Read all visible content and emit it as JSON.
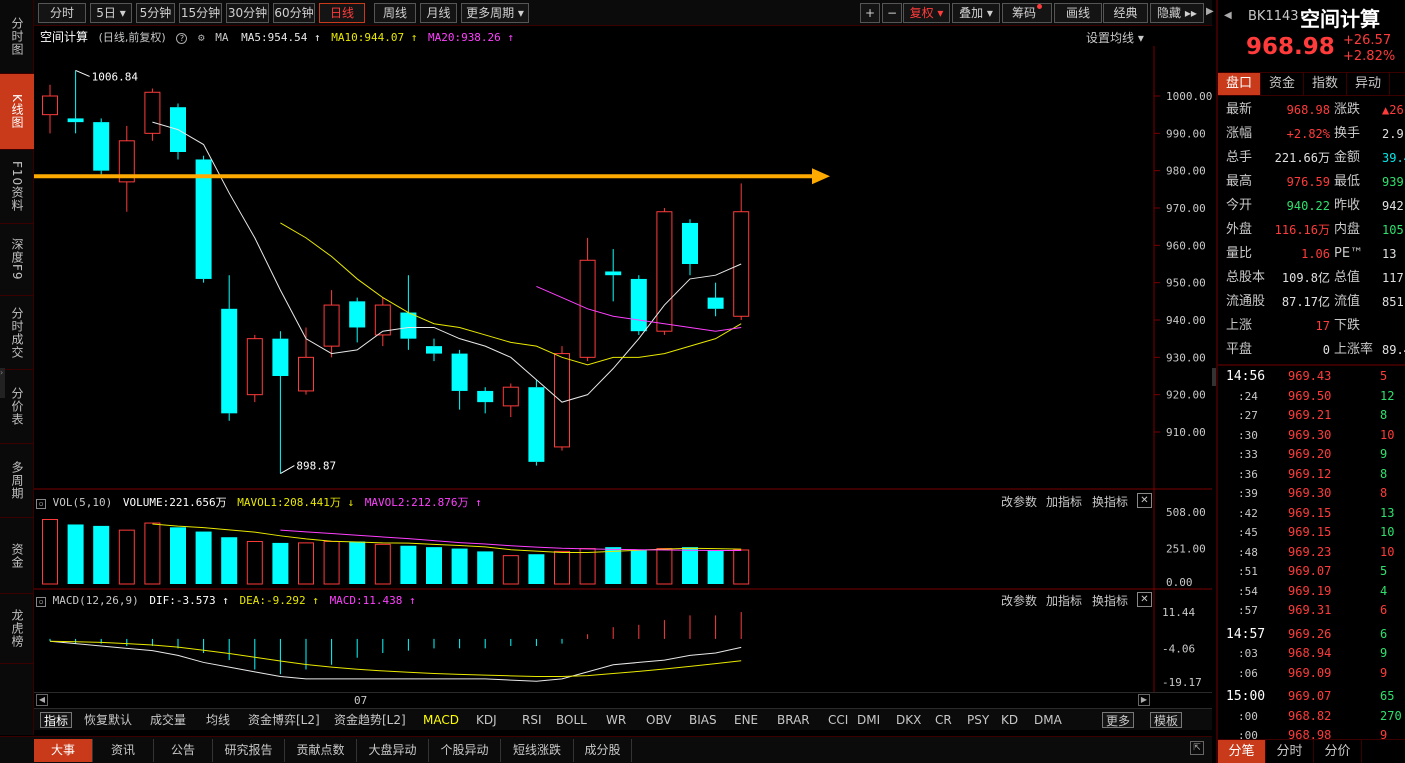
{
  "nav": [
    "分时图",
    "K线图",
    "F10资料",
    "深度F9",
    "分时成交",
    "分价表",
    "多周期",
    "资金",
    "龙虎榜"
  ],
  "periods": [
    "分时",
    "5日",
    "5分钟",
    "15分钟",
    "30分钟",
    "60分钟",
    "日线",
    "周线",
    "月线",
    "更多周期"
  ],
  "toolbar_right": {
    "plus": "+",
    "minus": "−",
    "fuquan": "复权",
    "overlay": "叠加",
    "chips": "筹码",
    "draw": "画线",
    "classic": "经典",
    "hide": "隐藏"
  },
  "chart_header": {
    "name": "空间计算",
    "mode": "(日线,前复权)",
    "ma_label": "MA",
    "ma5": "MA5:954.54",
    "ma10": "MA10:944.07",
    "ma20": "MA20:938.26",
    "settings": "设置均线"
  },
  "price_axis": [
    "1000.00",
    "990.00",
    "980.00",
    "970.00",
    "960.00",
    "950.00",
    "940.00",
    "930.00",
    "920.00",
    "910.00"
  ],
  "annotations": {
    "high": "1006.84",
    "low": "898.87"
  },
  "chart_data": {
    "type": "candlestick",
    "ylim": [
      900,
      1005
    ],
    "candles": [
      {
        "o": 995,
        "c": 1000,
        "h": 1003,
        "l": 990
      },
      {
        "o": 994,
        "c": 993,
        "h": 1006.84,
        "l": 990
      },
      {
        "o": 993,
        "c": 980,
        "h": 994,
        "l": 979
      },
      {
        "o": 977,
        "c": 988,
        "h": 992,
        "l": 969
      },
      {
        "o": 990,
        "c": 1001,
        "h": 1002,
        "l": 988
      },
      {
        "o": 997,
        "c": 985,
        "h": 998,
        "l": 983
      },
      {
        "o": 983,
        "c": 951,
        "h": 984,
        "l": 950
      },
      {
        "o": 943,
        "c": 915,
        "h": 952,
        "l": 913
      },
      {
        "o": 920,
        "c": 935,
        "h": 936,
        "l": 918
      },
      {
        "o": 935,
        "c": 925,
        "h": 937,
        "l": 898.87
      },
      {
        "o": 921,
        "c": 930,
        "h": 938,
        "l": 920
      },
      {
        "o": 933,
        "c": 944,
        "h": 948,
        "l": 930
      },
      {
        "o": 945,
        "c": 938,
        "h": 946,
        "l": 934
      },
      {
        "o": 936,
        "c": 944,
        "h": 946,
        "l": 933
      },
      {
        "o": 942,
        "c": 935,
        "h": 952,
        "l": 932
      },
      {
        "o": 933,
        "c": 931,
        "h": 935,
        "l": 929
      },
      {
        "o": 931,
        "c": 921,
        "h": 932,
        "l": 916
      },
      {
        "o": 921,
        "c": 918,
        "h": 922,
        "l": 915
      },
      {
        "o": 917,
        "c": 922,
        "h": 923,
        "l": 914
      },
      {
        "o": 922,
        "c": 902,
        "h": 924,
        "l": 901
      },
      {
        "o": 906,
        "c": 931,
        "h": 933,
        "l": 905
      },
      {
        "o": 930,
        "c": 956,
        "h": 962,
        "l": 929
      },
      {
        "o": 953,
        "c": 952,
        "h": 959,
        "l": 945
      },
      {
        "o": 951,
        "c": 937,
        "h": 952,
        "l": 936
      },
      {
        "o": 937,
        "c": 969,
        "h": 970,
        "l": 936
      },
      {
        "o": 966,
        "c": 955,
        "h": 967,
        "l": 952
      },
      {
        "o": 946,
        "c": 943,
        "h": 950,
        "l": 941
      },
      {
        "o": 941,
        "c": 969,
        "h": 976.59,
        "l": 940
      }
    ],
    "ma5": [
      null,
      null,
      null,
      null,
      993,
      991,
      987,
      974,
      962,
      948,
      935,
      931,
      932,
      937,
      938,
      938,
      935,
      933,
      930,
      924,
      918,
      920,
      927,
      935,
      944,
      951,
      952,
      955
    ],
    "ma10": [
      null,
      null,
      null,
      null,
      null,
      null,
      null,
      null,
      null,
      966,
      962,
      957,
      951,
      946,
      942,
      939,
      938,
      936,
      934,
      933,
      930,
      928,
      930,
      930,
      931,
      933,
      935,
      939
    ],
    "ma20": [
      null,
      null,
      null,
      null,
      null,
      null,
      null,
      null,
      null,
      null,
      null,
      null,
      null,
      null,
      null,
      null,
      null,
      null,
      null,
      949,
      946,
      943,
      941,
      940,
      939,
      938,
      937,
      938
    ],
    "volume": [
      480,
      420,
      410,
      null,
      430,
      390,
      360,
      330,
      310,
      300,
      290,
      300,
      300,
      280,
      270,
      250,
      250,
      230,
      200,
      200,
      230,
      240,
      260,
      240,
      250,
      250,
      240,
      240
    ]
  },
  "vol_panel": {
    "name": "VOL(5,10)",
    "volume": "VOLUME:221.656万",
    "mavol1": "MAVOL1:208.441万",
    "mavol2": "MAVOL2:212.876万",
    "axis": [
      "508.00",
      "251.00",
      "0.00"
    ]
  },
  "macd_panel": {
    "name": "MACD(12,26,9)",
    "dif": "DIF:-3.573",
    "dea": "DEA:-9.292",
    "macd": "MACD:11.438",
    "axis": [
      "11.44",
      "-4.06",
      "-19.17"
    ],
    "date": "07",
    "bars": [
      -1,
      -2,
      -2,
      -3,
      -3,
      -4,
      -6,
      -9,
      -13,
      -15,
      -13,
      -11,
      -8,
      -6,
      -5,
      -4,
      -4,
      -4,
      -3,
      -3,
      -2,
      2,
      5,
      6,
      8,
      10,
      10,
      11.4
    ]
  },
  "panel_tools": {
    "change_params": "改参数",
    "add_ind": "加指标",
    "swap_ind": "换指标",
    "close": "✕"
  },
  "indicators": [
    "指标",
    "恢复默认",
    "成交量",
    "均线",
    "资金博弈[L2]",
    "资金趋势[L2]",
    "MACD",
    "KDJ",
    "RSI",
    "BOLL",
    "WR",
    "OBV",
    "BIAS",
    "ENE",
    "BRAR",
    "CCI",
    "DMI",
    "DKX",
    "CR",
    "PSY",
    "KD",
    "DMA",
    "更多",
    "模板"
  ],
  "bottom_tabs": [
    "大事",
    "资讯",
    "公告",
    "研究报告",
    "贡献点数",
    "大盘异动",
    "个股异动",
    "短线涨跌",
    "成分股"
  ],
  "quote": {
    "code": "BK1143",
    "name": "空间计算",
    "price": "968.98",
    "change": "+26.57",
    "pct": "+2.82%",
    "tabs": [
      "盘口",
      "资金",
      "指数",
      "异动",
      "板"
    ],
    "rows": [
      [
        "最新",
        "968.98",
        "涨跌",
        "▲26"
      ],
      [
        "涨幅",
        "+2.82%",
        "换手",
        "2.9"
      ],
      [
        "总手",
        "221.66万",
        "金额",
        "39.4"
      ],
      [
        "最高",
        "976.59",
        "最低",
        "939"
      ],
      [
        "今开",
        "940.22",
        "昨收",
        "942"
      ],
      [
        "外盘",
        "116.16万",
        "内盘",
        "105.5"
      ],
      [
        "量比",
        "1.06",
        "PE™",
        "13"
      ],
      [
        "总股本",
        "109.8亿",
        "总值",
        "117"
      ],
      [
        "流通股",
        "87.17亿",
        "流值",
        "851."
      ],
      [
        "上涨",
        "17",
        "下跌",
        ""
      ],
      [
        "平盘",
        "0",
        "上涨率",
        "89.4"
      ]
    ],
    "ticks": [
      [
        "14:56",
        "969.43",
        "5"
      ],
      [
        ":24",
        "969.50",
        "12"
      ],
      [
        ":27",
        "969.21",
        "8"
      ],
      [
        ":30",
        "969.30",
        "10"
      ],
      [
        ":33",
        "969.20",
        "9"
      ],
      [
        ":36",
        "969.12",
        "8"
      ],
      [
        ":39",
        "969.30",
        "8"
      ],
      [
        ":42",
        "969.15",
        "13"
      ],
      [
        ":45",
        "969.15",
        "10"
      ],
      [
        ":48",
        "969.23",
        "10"
      ],
      [
        ":51",
        "969.07",
        "5"
      ],
      [
        ":54",
        "969.19",
        "4"
      ],
      [
        ":57",
        "969.31",
        "6"
      ],
      [
        "14:57",
        "969.26",
        "6"
      ],
      [
        ":03",
        "968.94",
        "9"
      ],
      [
        ":06",
        "969.09",
        "9"
      ],
      [
        "15:00",
        "969.07",
        "65"
      ],
      [
        ":00",
        "968.82",
        "270"
      ],
      [
        ":00",
        "968.98",
        "9"
      ]
    ],
    "bottom_tabs": [
      "分笔",
      "分时",
      "分价"
    ]
  }
}
